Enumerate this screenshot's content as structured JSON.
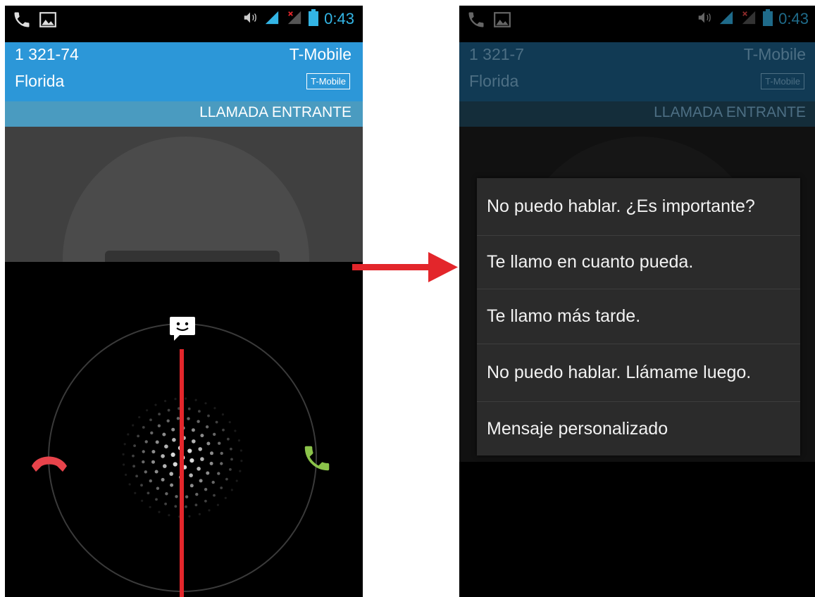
{
  "left_screen": {
    "status_bar": {
      "time": "0:43",
      "icons": [
        "phone-call-icon",
        "gallery-icon",
        "volume-icon",
        "signal-icon",
        "no-sim-signal-icon",
        "battery-icon"
      ]
    },
    "caller": {
      "number": "1 321-74",
      "location": "Florida",
      "carrier": "T-Mobile",
      "carrier_badge": "T-Mobile"
    },
    "call_state": "LLAMADA ENTRANTE",
    "controls": {
      "decline_icon": "decline-call-icon",
      "answer_icon": "answer-call-icon",
      "message_icon": "quick-reply-icon"
    }
  },
  "right_screen": {
    "status_bar": {
      "time": "0:43"
    },
    "caller": {
      "number": "1 321-7",
      "location": "Florida",
      "carrier": "T-Mobile",
      "carrier_badge": "T-Mobile"
    },
    "call_state": "LLAMADA ENTRANTE",
    "quick_replies": [
      {
        "label": "No puedo hablar. ¿Es importante?"
      },
      {
        "label": "Te llamo en cuanto pueda."
      },
      {
        "label": "Te llamo más tarde."
      },
      {
        "label": "No puedo hablar. Llámame luego."
      },
      {
        "label": "Mensaje personalizado"
      }
    ]
  },
  "colors": {
    "accent_blue": "#2c97d8",
    "decline_red": "#e8434b",
    "answer_green": "#8bc34a",
    "annotation_red": "#e3262b"
  }
}
